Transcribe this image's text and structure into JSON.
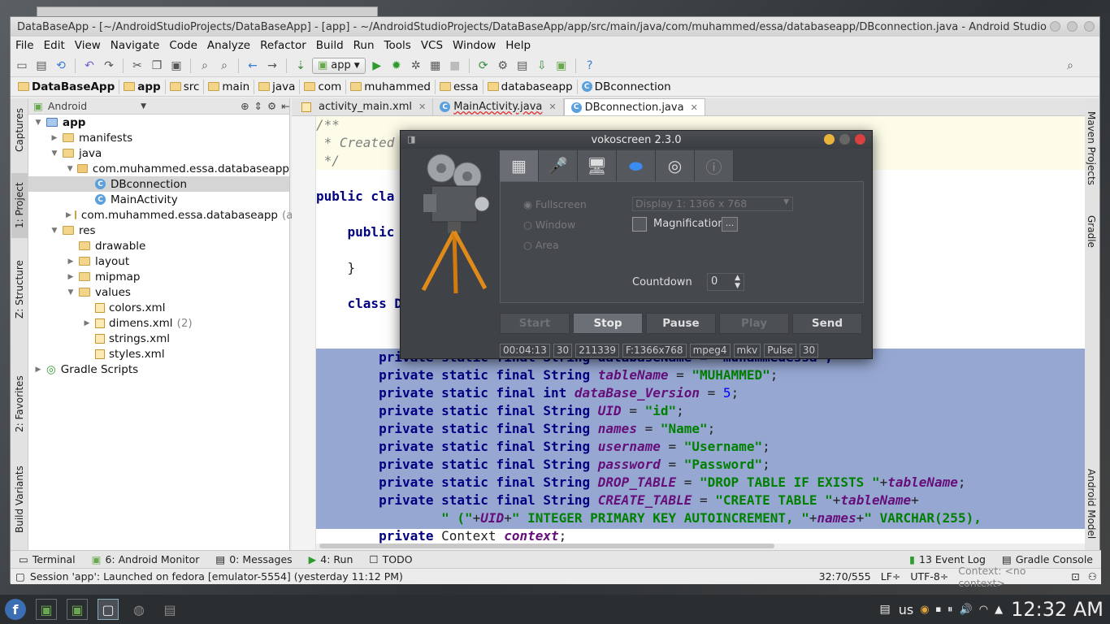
{
  "window": {
    "title": "DataBaseApp - [~/AndroidStudioProjects/DataBaseApp] - [app] - ~/AndroidStudioProjects/DataBaseApp/app/src/main/java/com/muhammed/essa/databaseapp/DBconnection.java - Android Studio ..."
  },
  "menu": [
    "File",
    "Edit",
    "View",
    "Navigate",
    "Code",
    "Analyze",
    "Refactor",
    "Build",
    "Run",
    "Tools",
    "VCS",
    "Window",
    "Help"
  ],
  "toolbar": {
    "run_config": "app"
  },
  "breadcrumbs": [
    "DataBaseApp",
    "app",
    "src",
    "main",
    "java",
    "com",
    "muhammed",
    "essa",
    "databaseapp",
    "DBconnection"
  ],
  "left_tabs": [
    "Captures",
    "1: Project",
    "Z: Structure",
    "2: Favorites",
    "Build Variants"
  ],
  "right_tabs": [
    "Maven Projects",
    "Gradle",
    "Android Model"
  ],
  "project_panel": {
    "view": "Android",
    "tree": [
      {
        "label": "app",
        "level": 0,
        "expanded": true,
        "icon": "module-folder-icon",
        "bold": true
      },
      {
        "label": "manifests",
        "level": 1,
        "expanded": false,
        "icon": "folder-icon"
      },
      {
        "label": "java",
        "level": 1,
        "expanded": true,
        "icon": "folder-icon"
      },
      {
        "label": "com.muhammed.essa.databaseapp",
        "level": 2,
        "expanded": true,
        "icon": "package-icon"
      },
      {
        "label": "DBconnection",
        "level": 3,
        "icon": "class-icon",
        "selected": true
      },
      {
        "label": "MainActivity",
        "level": 3,
        "icon": "class-icon"
      },
      {
        "label": "com.muhammed.essa.databaseapp",
        "level": 2,
        "expanded": false,
        "icon": "package-icon",
        "suffix": "(a"
      },
      {
        "label": "res",
        "level": 1,
        "expanded": true,
        "icon": "folder-icon"
      },
      {
        "label": "drawable",
        "level": 2,
        "icon": "folder-icon"
      },
      {
        "label": "layout",
        "level": 2,
        "expanded": false,
        "icon": "folder-icon"
      },
      {
        "label": "mipmap",
        "level": 2,
        "expanded": false,
        "icon": "folder-icon"
      },
      {
        "label": "values",
        "level": 2,
        "expanded": true,
        "icon": "folder-icon"
      },
      {
        "label": "colors.xml",
        "level": 3,
        "icon": "xml-icon"
      },
      {
        "label": "dimens.xml",
        "level": 3,
        "expanded": false,
        "icon": "xml-icon",
        "suffix": "(2)"
      },
      {
        "label": "strings.xml",
        "level": 3,
        "icon": "xml-icon"
      },
      {
        "label": "styles.xml",
        "level": 3,
        "icon": "xml-icon"
      },
      {
        "label": "Gradle Scripts",
        "level": 0,
        "expanded": false,
        "icon": "gradle-icon"
      }
    ]
  },
  "editor_tabs": [
    {
      "label": "activity_main.xml",
      "icon": "xml-icon",
      "active": false
    },
    {
      "label": "MainActivity.java",
      "icon": "class-icon",
      "active": false
    },
    {
      "label": "DBconnection.java",
      "icon": "class-icon",
      "active": true
    }
  ],
  "code": {
    "l1": "/**",
    "l2": " * Created",
    "l3": " */",
    "l4a": "public cla",
    "l5a": "    public",
    "l6": "    }",
    "l7a": "    class D",
    "s1": "        private static final String databaseName = \"muhammedessa\";",
    "s2a": "        private static final String ",
    "s2b": "tableName",
    "s2c": " = ",
    "s2d": "\"MUHAMMED\"",
    "s2e": ";",
    "s3a": "        private static final int ",
    "s3b": "dataBase_Version",
    "s3c": " = ",
    "s3d": "5",
    "s3e": ";",
    "s4a": "        private static final String ",
    "s4b": "UID",
    "s4c": " = ",
    "s4d": "\"id\"",
    "s4e": ";",
    "s5a": "        private static final String ",
    "s5b": "names",
    "s5c": " = ",
    "s5d": "\"Name\"",
    "s5e": ";",
    "s6a": "        private static final String ",
    "s6b": "username",
    "s6c": " = ",
    "s6d": "\"Username\"",
    "s6e": ";",
    "s7a": "        private static final String ",
    "s7b": "password",
    "s7c": " = ",
    "s7d": "\"Password\"",
    "s7e": ";",
    "s8a": "        private static final String ",
    "s8b": "DROP_TABLE",
    "s8c": " = ",
    "s8d": "\"DROP TABLE IF EXISTS \"",
    "s8e": "+",
    "s8f": "tableName",
    "s8g": ";",
    "s9a": "        private static final String ",
    "s9b": "CREATE_TABLE",
    "s9c": " = ",
    "s9d": "\"CREATE TABLE \"",
    "s9e": "+",
    "s9f": "tableName",
    "s9g": "+",
    "s10a": "                \" (\"",
    "s10b": "+",
    "s10c": "UID",
    "s10d": "+",
    "s10e": "\" INTEGER PRIMARY KEY AUTOINCREMENT, \"",
    "s10f": "+",
    "s10g": "names",
    "s10h": "+",
    "s10i": "\" VARCHAR(255),",
    "s11a": "        private ",
    "s11b": "Context ",
    "s11c": "context",
    "s11d": ";"
  },
  "bottom_tabs": [
    "Terminal",
    "6: Android Monitor",
    "0: Messages",
    "4: Run",
    "TODO",
    "13 Event Log",
    "Gradle Console"
  ],
  "status": {
    "message": "Session 'app': Launched on fedora [emulator-5554] (yesterday 11:12 PM)",
    "position": "32:70/555",
    "line_sep": "LF÷",
    "encoding": "UTF-8÷",
    "context": "Context: <no context>"
  },
  "vokoscreen": {
    "title": "vokoscreen 2.3.0",
    "modes": [
      "Fullscreen",
      "Window",
      "Area"
    ],
    "display": "Display 1:  1366 x 768",
    "magnification": "Magnification",
    "magnification_btn": "...",
    "countdown_label": "Countdown",
    "countdown_value": "0",
    "buttons": [
      "Start",
      "Stop",
      "Pause",
      "Play",
      "Send"
    ],
    "status": [
      "00:04:13",
      "30",
      "211339",
      "F:1366x768",
      "mpeg4",
      "mkv",
      "Pulse",
      "30"
    ]
  },
  "taskbar": {
    "lang": "us",
    "time": "12:32 AM"
  }
}
